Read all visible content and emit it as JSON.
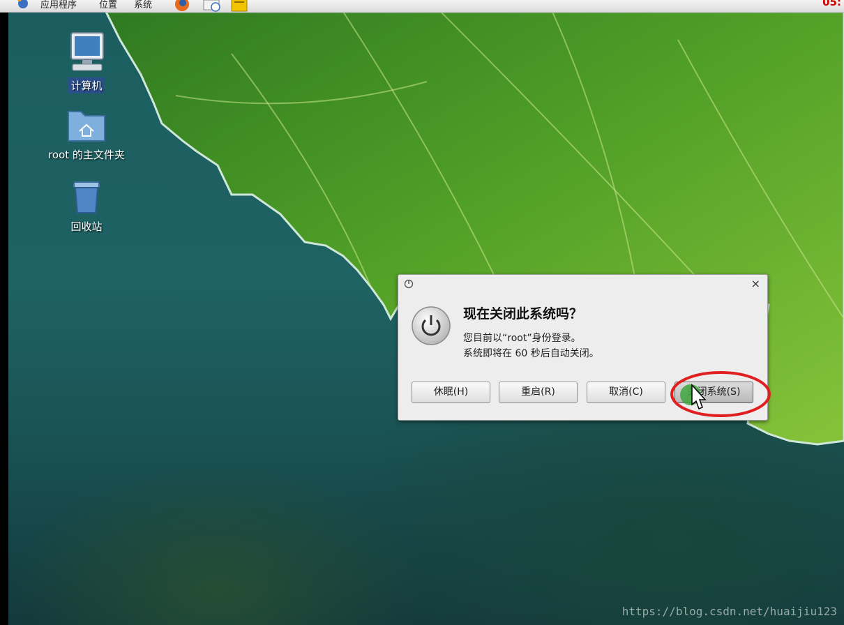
{
  "topbar": {
    "menus": [
      "应用程序",
      "位置",
      "系统"
    ],
    "clock": "05:"
  },
  "desktop_icons": [
    {
      "label": "计算机",
      "icon": "computer-icon"
    },
    {
      "label": "root 的主文件夹",
      "icon": "home-folder-icon"
    },
    {
      "label": "回收站",
      "icon": "trash-icon"
    }
  ],
  "dialog": {
    "title": "现在关闭此系统吗？",
    "message_line1": "您目前以“root”身份登录。",
    "message_line2": "系统即将在 60 秒后自动关闭。",
    "close_glyph": "×",
    "buttons": {
      "hibernate": "休眠(H)",
      "restart": "重启(R)",
      "cancel": "取消(C)",
      "shutdown": "关闭系统(S)"
    }
  },
  "watermark": "https://blog.csdn.net/huaijiu123",
  "colors": {
    "annotation_ring": "#e02020",
    "cursor_highlight": "#3ea63e",
    "clock": "#d00000"
  }
}
